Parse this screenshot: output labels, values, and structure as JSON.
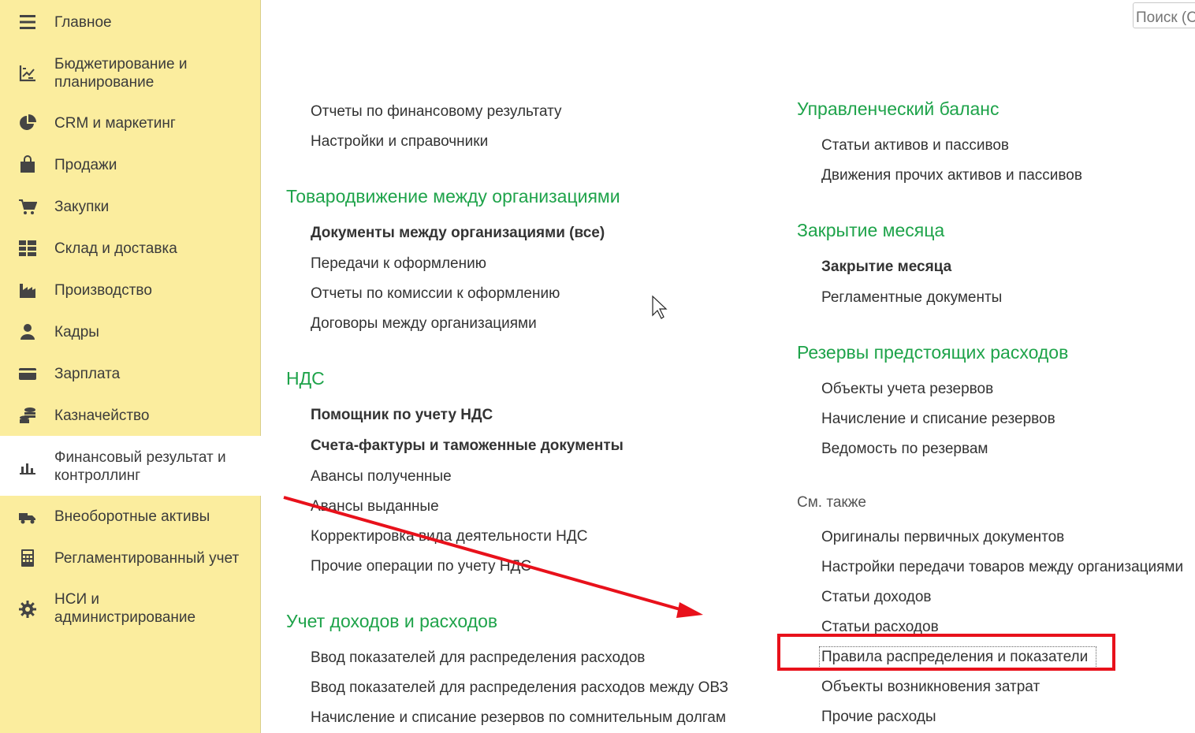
{
  "sidebar": {
    "items": [
      {
        "label": "Главное",
        "icon": "menu-icon",
        "active": false
      },
      {
        "label": "Бюджетирование и\nпланирование",
        "icon": "budget-chart-icon",
        "active": false
      },
      {
        "label": "CRM и маркетинг",
        "icon": "pie-chart-icon",
        "active": false
      },
      {
        "label": "Продажи",
        "icon": "shopping-bag-icon",
        "active": false
      },
      {
        "label": "Закупки",
        "icon": "cart-icon",
        "active": false
      },
      {
        "label": "Склад и доставка",
        "icon": "warehouse-grid-icon",
        "active": false
      },
      {
        "label": "Производство",
        "icon": "factory-icon",
        "active": false
      },
      {
        "label": "Кадры",
        "icon": "person-icon",
        "active": false
      },
      {
        "label": "Зарплата",
        "icon": "wallet-card-icon",
        "active": false
      },
      {
        "label": "Казначейство",
        "icon": "coins-icon",
        "active": false
      },
      {
        "label": "Финансовый результат и\nконтроллинг",
        "icon": "bar-chart-icon",
        "active": true
      },
      {
        "label": "Внеоборотные активы",
        "icon": "truck-icon",
        "active": false
      },
      {
        "label": "Регламентированный учет",
        "icon": "calculator-icon",
        "active": false
      },
      {
        "label": "НСИ и\nадминистрирование",
        "icon": "gear-icon",
        "active": false
      }
    ]
  },
  "search": {
    "placeholder": "Поиск (Ctrl+F)"
  },
  "left_column": {
    "top_links": [
      "Отчеты по финансовому результату",
      "Настройки и справочники"
    ],
    "sections": [
      {
        "title": "Товародвижение между организациями",
        "links": [
          {
            "label": "Документы между организациями (все)",
            "bold": true
          },
          {
            "label": "Передачи к оформлению",
            "bold": false
          },
          {
            "label": "Отчеты по комиссии к оформлению",
            "bold": false
          },
          {
            "label": "Договоры между организациями",
            "bold": false
          }
        ]
      },
      {
        "title": "НДС",
        "links": [
          {
            "label": "Помощник по учету НДС",
            "bold": true
          },
          {
            "label": "Счета-фактуры и таможенные документы",
            "bold": true
          },
          {
            "label": "Авансы полученные",
            "bold": false
          },
          {
            "label": "Авансы выданные",
            "bold": false
          },
          {
            "label": "Корректировка вида деятельности НДС",
            "bold": false
          },
          {
            "label": "Прочие операции по учету НДС",
            "bold": false
          }
        ]
      },
      {
        "title": "Учет доходов и расходов",
        "links": [
          {
            "label": "Ввод показателей для распределения расходов",
            "bold": false
          },
          {
            "label": "Ввод показателей для распределения расходов между ОВЗ",
            "bold": false
          },
          {
            "label": "Начисление и списание резервов по сомнительным долгам",
            "bold": false
          }
        ]
      }
    ]
  },
  "right_column": {
    "sections": [
      {
        "title": "Управленческий баланс",
        "links": [
          {
            "label": "Статьи активов и пассивов",
            "bold": false
          },
          {
            "label": "Движения прочих активов и пассивов",
            "bold": false
          }
        ]
      },
      {
        "title": "Закрытие месяца",
        "links": [
          {
            "label": "Закрытие месяца",
            "bold": true
          },
          {
            "label": "Регламентные документы",
            "bold": false
          }
        ]
      },
      {
        "title": "Резервы предстоящих расходов",
        "links": [
          {
            "label": "Объекты учета резервов",
            "bold": false
          },
          {
            "label": "Начисление и списание резервов",
            "bold": false
          },
          {
            "label": "Ведомость по резервам",
            "bold": false
          }
        ]
      }
    ],
    "see_also": {
      "title": "См. также",
      "links": [
        "Оригиналы первичных документов",
        "Настройки передачи товаров между организациями",
        "Статьи доходов",
        "Статьи расходов",
        "Правила распределения и показатели",
        "Объекты возникновения затрат",
        "Прочие расходы"
      ]
    }
  },
  "colors": {
    "sidebar_bg": "#fbed9e",
    "section_title": "#1ea34a",
    "annotation_red": "#e8111b"
  }
}
